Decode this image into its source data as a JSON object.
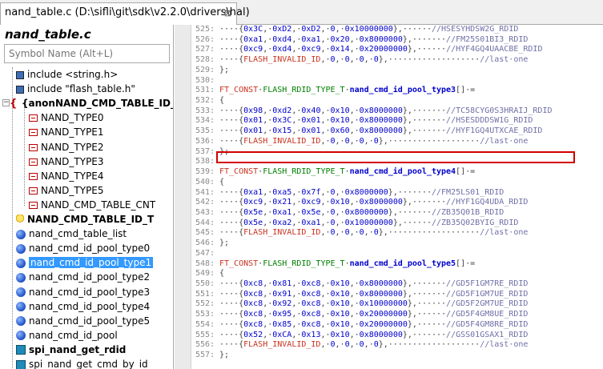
{
  "tab": {
    "title": "nand_table.c (D:\\sifli\\git\\sdk\\v2.2.0\\drivers\\hal)",
    "close": "⊠"
  },
  "sidebar": {
    "title": "nand_table.c",
    "search_placeholder": "Symbol Name (Alt+L)",
    "items": [
      {
        "label": "include <string.h>",
        "icon": "include-icon",
        "bold": false
      },
      {
        "label": "include \"flash_table.h\"",
        "icon": "include-icon",
        "bold": false
      },
      {
        "label": "{anonNAND_CMD_TABLE_ID_",
        "icon": "struct-icon",
        "bold": true
      },
      {
        "label": "NAND_TYPE0",
        "icon": "enum-member-icon",
        "bold": false
      },
      {
        "label": "NAND_TYPE1",
        "icon": "enum-member-icon",
        "bold": false
      },
      {
        "label": "NAND_TYPE2",
        "icon": "enum-member-icon",
        "bold": false
      },
      {
        "label": "NAND_TYPE3",
        "icon": "enum-member-icon",
        "bold": false
      },
      {
        "label": "NAND_TYPE4",
        "icon": "enum-member-icon",
        "bold": false
      },
      {
        "label": "NAND_TYPE5",
        "icon": "enum-member-icon",
        "bold": false
      },
      {
        "label": "NAND_CMD_TABLE_CNT",
        "icon": "enum-member-icon",
        "bold": false
      },
      {
        "label": "NAND_CMD_TABLE_ID_T",
        "icon": "typedef-icon",
        "bold": true
      },
      {
        "label": "nand_cmd_table_list",
        "icon": "variable-icon",
        "bold": false
      },
      {
        "label": "nand_cmd_id_pool_type0",
        "icon": "variable-icon",
        "bold": false
      },
      {
        "label": "nand_cmd_id_pool_type1",
        "icon": "variable-icon",
        "bold": false,
        "selected": true
      },
      {
        "label": "nand_cmd_id_pool_type2",
        "icon": "variable-icon",
        "bold": false
      },
      {
        "label": "nand_cmd_id_pool_type3",
        "icon": "variable-icon",
        "bold": false
      },
      {
        "label": "nand_cmd_id_pool_type4",
        "icon": "variable-icon",
        "bold": false
      },
      {
        "label": "nand_cmd_id_pool_type5",
        "icon": "variable-icon",
        "bold": false
      },
      {
        "label": "nand_cmd_id_pool",
        "icon": "variable-icon",
        "bold": false
      },
      {
        "label": "spi_nand_get_rdid",
        "icon": "function-icon",
        "bold": true
      },
      {
        "label": "spi_nand_get_cmd_by_id",
        "icon": "function-icon",
        "bold": false
      }
    ]
  },
  "code_lines": [
    {
      "n": "525:",
      "segs": [
        [
          "pun",
          "····{"
        ],
        [
          "num",
          "0x3C"
        ],
        [
          "pun",
          ",·"
        ],
        [
          "num",
          "0xD2"
        ],
        [
          "pun",
          ",·"
        ],
        [
          "num",
          "0xD2"
        ],
        [
          "pun",
          ",·"
        ],
        [
          "num",
          "0"
        ],
        [
          "pun",
          ",·"
        ],
        [
          "num",
          "0x10000000"
        ],
        [
          "pun",
          "},······"
        ],
        [
          "cmt",
          "//HSESYHDSW2G_RDID"
        ]
      ]
    },
    {
      "n": "526:",
      "segs": [
        [
          "pun",
          "····{"
        ],
        [
          "num",
          "0xa1"
        ],
        [
          "pun",
          ",·"
        ],
        [
          "num",
          "0xd4"
        ],
        [
          "pun",
          ",·"
        ],
        [
          "num",
          "0xa1"
        ],
        [
          "pun",
          ",·"
        ],
        [
          "num",
          "0x20"
        ],
        [
          "pun",
          ",·"
        ],
        [
          "num",
          "0x8000000"
        ],
        [
          "pun",
          "},·······"
        ],
        [
          "cmt",
          "//FM25S01BI3_RDID"
        ]
      ]
    },
    {
      "n": "527:",
      "segs": [
        [
          "pun",
          "····{"
        ],
        [
          "num",
          "0xc9"
        ],
        [
          "pun",
          ",·"
        ],
        [
          "num",
          "0xd4"
        ],
        [
          "pun",
          ",·"
        ],
        [
          "num",
          "0xc9"
        ],
        [
          "pun",
          ",·"
        ],
        [
          "num",
          "0x14"
        ],
        [
          "pun",
          ",·"
        ],
        [
          "num",
          "0x20000000"
        ],
        [
          "pun",
          "},······"
        ],
        [
          "cmt",
          "//HYF4GQ4UAACBE_RDID"
        ]
      ]
    },
    {
      "n": "528:",
      "segs": [
        [
          "pun",
          "····{"
        ],
        [
          "kw",
          "FLASH_INVALID_ID"
        ],
        [
          "pun",
          ",·"
        ],
        [
          "num",
          "0"
        ],
        [
          "pun",
          ",·"
        ],
        [
          "num",
          "0"
        ],
        [
          "pun",
          ",·"
        ],
        [
          "num",
          "0"
        ],
        [
          "pun",
          ",·"
        ],
        [
          "num",
          "0"
        ],
        [
          "pun",
          "},···················"
        ],
        [
          "cmt",
          "//last·one"
        ]
      ]
    },
    {
      "n": "529:",
      "segs": [
        [
          "pun",
          "};"
        ]
      ]
    },
    {
      "n": "530:",
      "segs": []
    },
    {
      "n": "531:",
      "segs": [
        [
          "ty",
          "FT_CONST"
        ],
        [
          "pun",
          "·"
        ],
        [
          "tn",
          "FLASH_RDID_TYPE_T"
        ],
        [
          "pun",
          "·"
        ],
        [
          "fn",
          "nand_cmd_id_pool_type3"
        ],
        [
          "pun",
          "[]·="
        ]
      ]
    },
    {
      "n": "532:",
      "segs": [
        [
          "pun",
          "{"
        ]
      ]
    },
    {
      "n": "533:",
      "segs": [
        [
          "pun",
          "····{"
        ],
        [
          "num",
          "0x98"
        ],
        [
          "pun",
          ",·"
        ],
        [
          "num",
          "0xd2"
        ],
        [
          "pun",
          ",·"
        ],
        [
          "num",
          "0x40"
        ],
        [
          "pun",
          ",·"
        ],
        [
          "num",
          "0x10"
        ],
        [
          "pun",
          ",·"
        ],
        [
          "num",
          "0x8000000"
        ],
        [
          "pun",
          "},·······"
        ],
        [
          "cmt",
          "//TC58CYG0S3HRAIJ_RDID"
        ]
      ]
    },
    {
      "n": "534:",
      "segs": [
        [
          "pun",
          "····{"
        ],
        [
          "num",
          "0x01"
        ],
        [
          "pun",
          ",·"
        ],
        [
          "num",
          "0x3C"
        ],
        [
          "pun",
          ",·"
        ],
        [
          "num",
          "0x01"
        ],
        [
          "pun",
          ",·"
        ],
        [
          "num",
          "0x10"
        ],
        [
          "pun",
          ",·"
        ],
        [
          "num",
          "0x8000000"
        ],
        [
          "pun",
          "},·······"
        ],
        [
          "cmt",
          "//HSESDDDSW1G_RDID"
        ]
      ]
    },
    {
      "n": "535:",
      "segs": [
        [
          "pun",
          "····{"
        ],
        [
          "num",
          "0x01"
        ],
        [
          "pun",
          ",·"
        ],
        [
          "num",
          "0x15"
        ],
        [
          "pun",
          ",·"
        ],
        [
          "num",
          "0x01"
        ],
        [
          "pun",
          ",·"
        ],
        [
          "num",
          "0x60"
        ],
        [
          "pun",
          ",·"
        ],
        [
          "num",
          "0x8000000"
        ],
        [
          "pun",
          "},·······"
        ],
        [
          "cmt",
          "//HYF1GQ4UTXCAE_RDID"
        ]
      ]
    },
    {
      "n": "536:",
      "segs": [
        [
          "pun",
          "····{"
        ],
        [
          "kw",
          "FLASH_INVALID_ID"
        ],
        [
          "pun",
          ",·"
        ],
        [
          "num",
          "0"
        ],
        [
          "pun",
          ",·"
        ],
        [
          "num",
          "0"
        ],
        [
          "pun",
          ",·"
        ],
        [
          "num",
          "0"
        ],
        [
          "pun",
          ",·"
        ],
        [
          "num",
          "0"
        ],
        [
          "pun",
          "},···················"
        ],
        [
          "cmt",
          "//last·one"
        ]
      ]
    },
    {
      "n": "537:",
      "segs": [
        [
          "pun",
          "};"
        ]
      ]
    },
    {
      "n": "538:",
      "segs": []
    },
    {
      "n": "539:",
      "segs": [
        [
          "ty",
          "FT_CONST"
        ],
        [
          "pun",
          "·"
        ],
        [
          "tn",
          "FLASH_RDID_TYPE_T"
        ],
        [
          "pun",
          "·"
        ],
        [
          "fn",
          "nand_cmd_id_pool_type4"
        ],
        [
          "pun",
          "[]·="
        ]
      ]
    },
    {
      "n": "540:",
      "segs": [
        [
          "pun",
          "{"
        ]
      ]
    },
    {
      "n": "541:",
      "segs": [
        [
          "pun",
          "····{"
        ],
        [
          "num",
          "0xa1"
        ],
        [
          "pun",
          ",·"
        ],
        [
          "num",
          "0xa5"
        ],
        [
          "pun",
          ",·"
        ],
        [
          "num",
          "0x7f"
        ],
        [
          "pun",
          ",·"
        ],
        [
          "num",
          "0"
        ],
        [
          "pun",
          ",·"
        ],
        [
          "num",
          "0x8000000"
        ],
        [
          "pun",
          "},·······"
        ],
        [
          "cmt",
          "//FM25LS01_RDID"
        ]
      ]
    },
    {
      "n": "542:",
      "segs": [
        [
          "pun",
          "····{"
        ],
        [
          "num",
          "0xc9"
        ],
        [
          "pun",
          ",·"
        ],
        [
          "num",
          "0x21"
        ],
        [
          "pun",
          ",·"
        ],
        [
          "num",
          "0xc9"
        ],
        [
          "pun",
          ",·"
        ],
        [
          "num",
          "0x10"
        ],
        [
          "pun",
          ",·"
        ],
        [
          "num",
          "0x8000000"
        ],
        [
          "pun",
          "},·······"
        ],
        [
          "cmt",
          "//HYF1GQ4UDA_RDID"
        ]
      ]
    },
    {
      "n": "543:",
      "segs": [
        [
          "pun",
          "····{"
        ],
        [
          "num",
          "0x5e"
        ],
        [
          "pun",
          ",·"
        ],
        [
          "num",
          "0xa1"
        ],
        [
          "pun",
          ",·"
        ],
        [
          "num",
          "0x5e"
        ],
        [
          "pun",
          ",·"
        ],
        [
          "num",
          "0"
        ],
        [
          "pun",
          ",·"
        ],
        [
          "num",
          "0x8000000"
        ],
        [
          "pun",
          "},·······"
        ],
        [
          "cmt",
          "//ZB35Q01B_RDID"
        ]
      ]
    },
    {
      "n": "544:",
      "segs": [
        [
          "pun",
          "····{"
        ],
        [
          "num",
          "0x5e"
        ],
        [
          "pun",
          ",·"
        ],
        [
          "num",
          "0xa2"
        ],
        [
          "pun",
          ",·"
        ],
        [
          "num",
          "0xa1"
        ],
        [
          "pun",
          ",·"
        ],
        [
          "num",
          "0"
        ],
        [
          "pun",
          ",·"
        ],
        [
          "num",
          "0x10000000"
        ],
        [
          "pun",
          "},······"
        ],
        [
          "cmt",
          "//ZB35Q02BYIG_RDID"
        ]
      ]
    },
    {
      "n": "545:",
      "segs": [
        [
          "pun",
          "····{"
        ],
        [
          "kw",
          "FLASH_INVALID_ID"
        ],
        [
          "pun",
          ",·"
        ],
        [
          "num",
          "0"
        ],
        [
          "pun",
          ",·"
        ],
        [
          "num",
          "0"
        ],
        [
          "pun",
          ",·"
        ],
        [
          "num",
          "0"
        ],
        [
          "pun",
          ",·"
        ],
        [
          "num",
          "0"
        ],
        [
          "pun",
          "},···················"
        ],
        [
          "cmt",
          "//last·one"
        ]
      ]
    },
    {
      "n": "546:",
      "segs": [
        [
          "pun",
          "};"
        ]
      ]
    },
    {
      "n": "547:",
      "segs": []
    },
    {
      "n": "548:",
      "segs": [
        [
          "ty",
          "FT_CONST"
        ],
        [
          "pun",
          "·"
        ],
        [
          "tn",
          "FLASH_RDID_TYPE_T"
        ],
        [
          "pun",
          "·"
        ],
        [
          "fn",
          "nand_cmd_id_pool_type5"
        ],
        [
          "pun",
          "[]·="
        ]
      ]
    },
    {
      "n": "549:",
      "segs": [
        [
          "pun",
          "{"
        ]
      ]
    },
    {
      "n": "550:",
      "segs": [
        [
          "pun",
          "····{"
        ],
        [
          "num",
          "0xc8"
        ],
        [
          "pun",
          ",·"
        ],
        [
          "num",
          "0x81"
        ],
        [
          "pun",
          ",·"
        ],
        [
          "num",
          "0xc8"
        ],
        [
          "pun",
          ",·"
        ],
        [
          "num",
          "0x10"
        ],
        [
          "pun",
          ",·"
        ],
        [
          "num",
          "0x8000000"
        ],
        [
          "pun",
          "},·······"
        ],
        [
          "cmt",
          "//GD5F1GM7RE_RDID"
        ]
      ]
    },
    {
      "n": "551:",
      "segs": [
        [
          "pun",
          "····{"
        ],
        [
          "num",
          "0xc8"
        ],
        [
          "pun",
          ",·"
        ],
        [
          "num",
          "0x91"
        ],
        [
          "pun",
          ",·"
        ],
        [
          "num",
          "0xc8"
        ],
        [
          "pun",
          ",·"
        ],
        [
          "num",
          "0x10"
        ],
        [
          "pun",
          ",·"
        ],
        [
          "num",
          "0x8000000"
        ],
        [
          "pun",
          "},·······"
        ],
        [
          "cmt",
          "//GD5F1GM7UE_RDID"
        ]
      ]
    },
    {
      "n": "552:",
      "segs": [
        [
          "pun",
          "····{"
        ],
        [
          "num",
          "0xc8"
        ],
        [
          "pun",
          ",·"
        ],
        [
          "num",
          "0x92"
        ],
        [
          "pun",
          ",·"
        ],
        [
          "num",
          "0xc8"
        ],
        [
          "pun",
          ",·"
        ],
        [
          "num",
          "0x10"
        ],
        [
          "pun",
          ",·"
        ],
        [
          "num",
          "0x10000000"
        ],
        [
          "pun",
          "},······"
        ],
        [
          "cmt",
          "//GD5F2GM7UE_RDID"
        ]
      ]
    },
    {
      "n": "553:",
      "segs": [
        [
          "pun",
          "····{"
        ],
        [
          "num",
          "0xc8"
        ],
        [
          "pun",
          ",·"
        ],
        [
          "num",
          "0x95"
        ],
        [
          "pun",
          ",·"
        ],
        [
          "num",
          "0xc8"
        ],
        [
          "pun",
          ",·"
        ],
        [
          "num",
          "0x10"
        ],
        [
          "pun",
          ",·"
        ],
        [
          "num",
          "0x20000000"
        ],
        [
          "pun",
          "},······"
        ],
        [
          "cmt",
          "//GD5F4GM8UE_RDID"
        ]
      ]
    },
    {
      "n": "554:",
      "segs": [
        [
          "pun",
          "····{"
        ],
        [
          "num",
          "0xc8"
        ],
        [
          "pun",
          ",·"
        ],
        [
          "num",
          "0x85"
        ],
        [
          "pun",
          ",·"
        ],
        [
          "num",
          "0xc8"
        ],
        [
          "pun",
          ",·"
        ],
        [
          "num",
          "0x10"
        ],
        [
          "pun",
          ",·"
        ],
        [
          "num",
          "0x20000000"
        ],
        [
          "pun",
          "},······"
        ],
        [
          "cmt",
          "//GD5F4GM8RE_RDID"
        ]
      ]
    },
    {
      "n": "555:",
      "segs": [
        [
          "pun",
          "····{"
        ],
        [
          "num",
          "0x52"
        ],
        [
          "pun",
          ",·"
        ],
        [
          "num",
          "0xCA"
        ],
        [
          "pun",
          ",·"
        ],
        [
          "num",
          "0x13"
        ],
        [
          "pun",
          ",·"
        ],
        [
          "num",
          "0x10"
        ],
        [
          "pun",
          ",·"
        ],
        [
          "num",
          "0x8000000"
        ],
        [
          "pun",
          "},·······"
        ],
        [
          "cmt",
          "//GSS01GSAX1_RDID"
        ]
      ]
    },
    {
      "n": "556:",
      "segs": [
        [
          "pun",
          "····{"
        ],
        [
          "kw",
          "FLASH_INVALID_ID"
        ],
        [
          "pun",
          ",·"
        ],
        [
          "num",
          "0"
        ],
        [
          "pun",
          ",·"
        ],
        [
          "num",
          "0"
        ],
        [
          "pun",
          ",·"
        ],
        [
          "num",
          "0"
        ],
        [
          "pun",
          ",·"
        ],
        [
          "num",
          "0"
        ],
        [
          "pun",
          "},···················"
        ],
        [
          "cmt",
          "//last·one"
        ]
      ]
    },
    {
      "n": "557:",
      "segs": [
        [
          "pun",
          "};"
        ]
      ]
    }
  ]
}
